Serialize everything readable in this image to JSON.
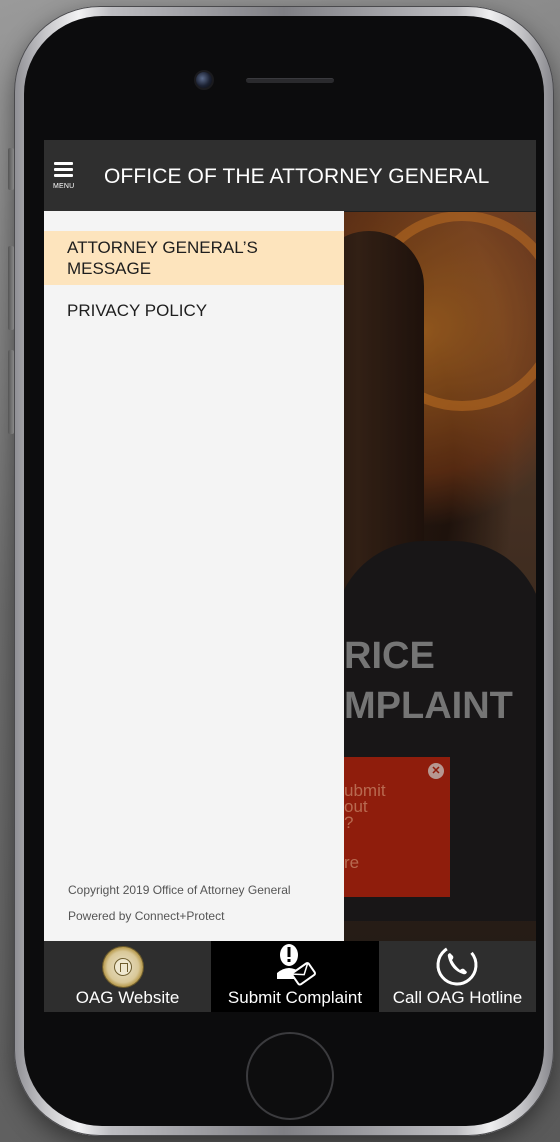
{
  "header": {
    "menu_label": "MENU",
    "title": "OFFICE OF THE ATTORNEY GENERAL"
  },
  "drawer": {
    "items": [
      {
        "label_line1": "ATTORNEY GENERAL’S",
        "label_line2": "MESSAGE",
        "active": true
      },
      {
        "label_line1": "PRIVACY POLICY",
        "active": false
      }
    ],
    "copyright": "Copyright 2019 Office of Attorney General",
    "powered_by": "Powered by Connect+Protect"
  },
  "background_content": {
    "hero_line1": "RICE",
    "hero_line2": "MPLAINT",
    "popup_lines": [
      "ubmit",
      "out",
      "?",
      "re"
    ]
  },
  "bottom_nav": {
    "items": [
      {
        "label": "OAG Website",
        "icon": "seal-icon"
      },
      {
        "label": "Submit Complaint",
        "icon": "complaint-icon",
        "active": true
      },
      {
        "label": "Call OAG Hotline",
        "icon": "phone-icon"
      }
    ]
  },
  "colors": {
    "header_bg": "#2f2f2f",
    "drawer_bg": "#f4f4f4",
    "active_item_bg": "#fde4bd",
    "nav_bg": "#2e2e2e",
    "nav_active_bg": "#000000",
    "popup_bg": "#a8230f"
  }
}
